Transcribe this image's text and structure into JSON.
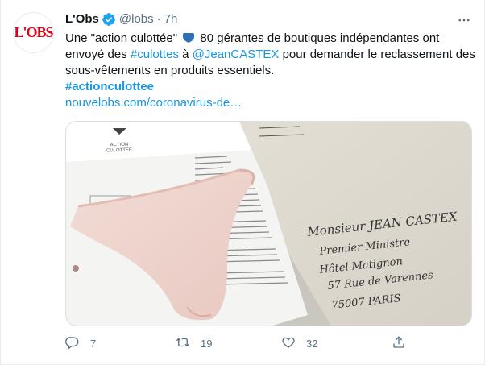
{
  "author": {
    "name": "L'Obs",
    "handle": "@lobs",
    "separator": "·",
    "time": "7h",
    "avatar_text": "L'OBS",
    "brand_color": "#e2001a"
  },
  "tweet": {
    "line1_pre": "Une \"action culottée\"",
    "line1_post": "80 gérantes de boutiques indépendantes ont",
    "line2_pre": "envoyé des",
    "hashtag_culottes": "#culottes",
    "line2_a": "à",
    "mention": "@JeanCASTEX",
    "line2_post": "pour demander le reclassement des",
    "line3": "sous-vêtements en produits essentiels.",
    "hashtag_line": "#actionculottee",
    "link": "nouvelobs.com/coronavirus-de…",
    "emoji": "blue-heart-icon",
    "link_color": "#1b95e0"
  },
  "media": {
    "letter_brand": "ACTION\nCULOTTEE",
    "envelope_lines": [
      "Monsieur JEAN CASTEX",
      "Premier Ministre",
      "Hôtel Matignon",
      "57 Rue de Varennes",
      "75007 PARIS"
    ]
  },
  "actions": {
    "reply_count": "7",
    "retweet_count": "19",
    "like_count": "32",
    "reply_icon": "reply-icon",
    "retweet_icon": "retweet-icon",
    "like_icon": "heart-icon",
    "share_icon": "share-icon"
  }
}
